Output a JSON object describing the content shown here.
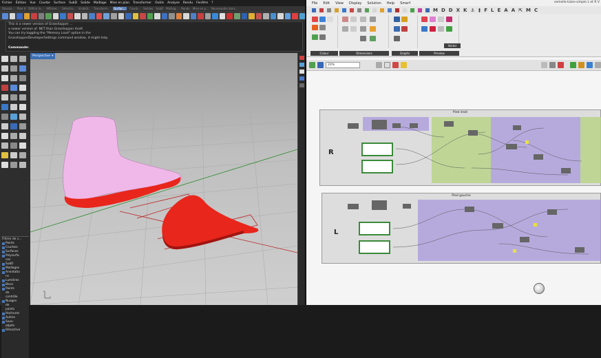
{
  "rhino": {
    "menu": [
      "Fichier",
      "Édition",
      "Vue",
      "Courbe",
      "Surface",
      "SubD",
      "Solide",
      "Maillage",
      "Mise en plan",
      "Transformer",
      "Outils",
      "Analyse",
      "Rendu",
      "Fenêtre",
      "?"
    ],
    "tabs": [
      "Standa...",
      "Plan d",
      "Définir la...",
      "Afficher...",
      "Sélectio...",
      "Visibilit...",
      "Transform...",
      "Surfac...",
      "Courb...",
      "Solides",
      "SubD",
      "Maillag...",
      "Rendu",
      "Mise en p...",
      "Nouveautés dans..."
    ],
    "active_tab": "Surfac...",
    "command_lines": [
      "This is a newer version of Grasshopper ...",
      "a newer version of .NET than Grasshopper itself.",
      "You can try toggling the \"Memory Load\" option in the",
      "GrasshopperDeveloperSettings command window, it might help."
    ],
    "command_prompt": "Commande:",
    "viewport_label": "Perspective",
    "layer_panel_title": "Filtres de s...",
    "layers": [
      "Points",
      "Courbes",
      "Surfaces",
      "Polysurfa\nces",
      "SubD",
      "Maillages",
      "Annotatio\nns",
      "Lumières",
      "Blocs",
      "Points\nde\ncontrôle",
      "Nuages\nde\npoints",
      "Hachures",
      "Autres",
      "Sous-\nobjets",
      "Désactive"
    ]
  },
  "grasshopper": {
    "menu": [
      "File",
      "Edit",
      "View",
      "Display",
      "Solution",
      "Help",
      "Smerf"
    ],
    "window_title": "semelle-talon-simple L et R V",
    "tab_letters": [
      "M",
      "D",
      "D",
      "X",
      "K",
      "⚓",
      "‡",
      "F",
      "L",
      "E",
      "A",
      "A",
      "⇱",
      "M",
      "C"
    ],
    "component_groups": [
      "Colour",
      "Dimensions",
      "Graphs",
      "Preview",
      "Vector"
    ],
    "zoom": "20%",
    "group_right_title": "Pied droit",
    "group_left_title": "Pied gauche",
    "label_right": "R",
    "label_left": "L"
  },
  "colors": {
    "rhino_bg": "#2b2b2b",
    "viewport_accent": "#3b6fb5",
    "foot_pink": "#f0b8e8",
    "sole_red": "#e8261c",
    "gh_group_green": "#b8d48a",
    "gh_group_purple": "#a898dc"
  }
}
